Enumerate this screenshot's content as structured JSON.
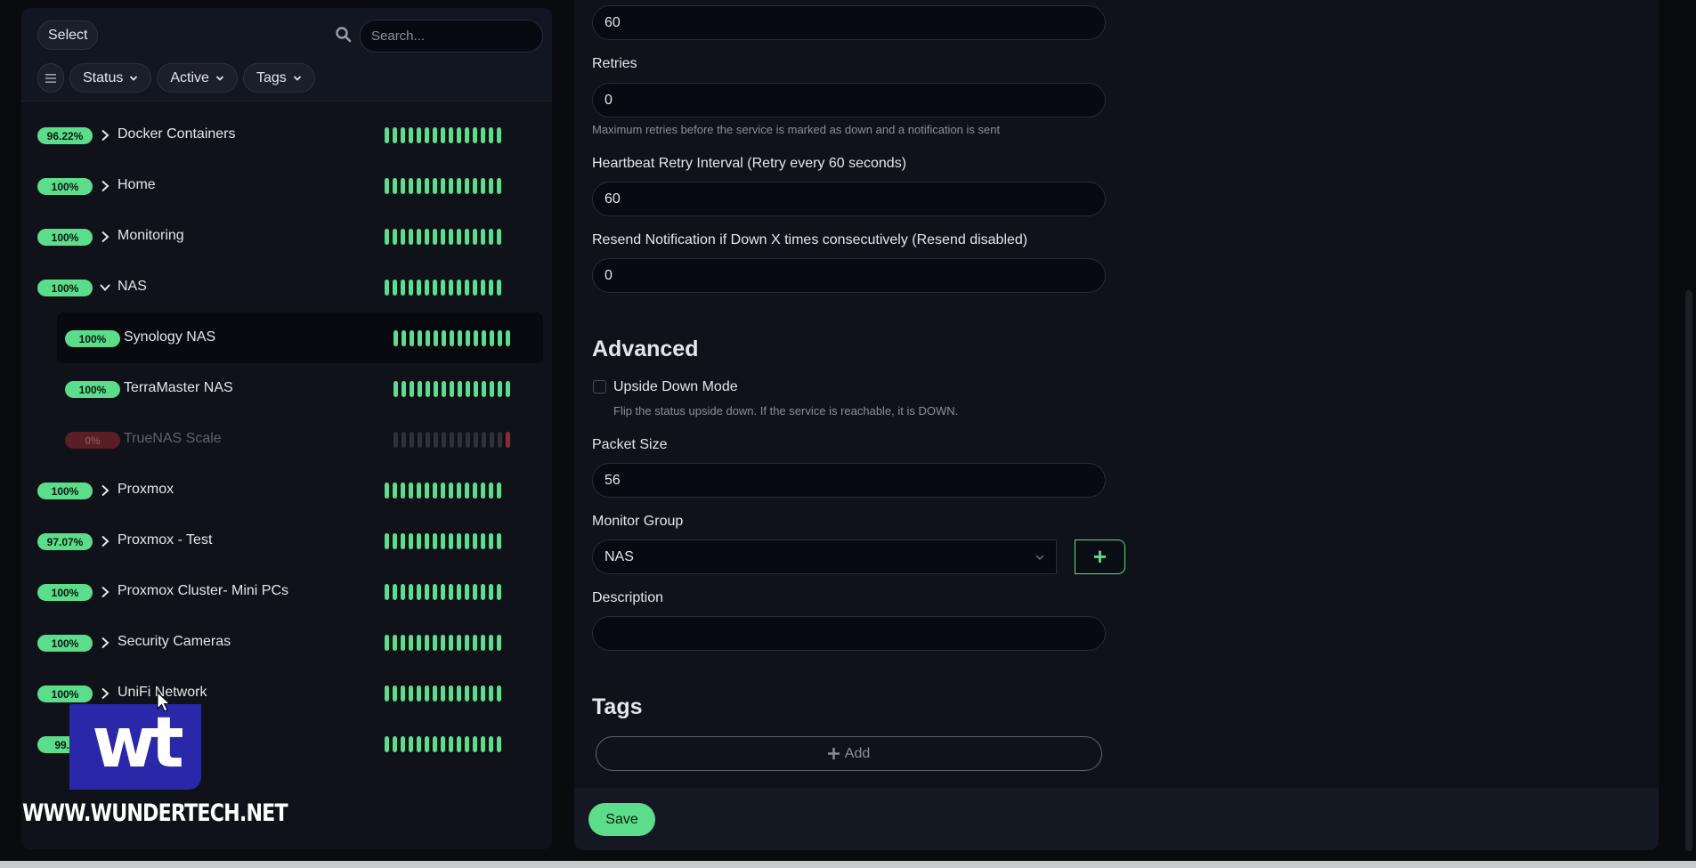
{
  "sidebar": {
    "select_label": "Select",
    "search_placeholder": "Search...",
    "filters": [
      {
        "label": "Status"
      },
      {
        "label": "Active"
      },
      {
        "label": "Tags"
      }
    ],
    "monitors": [
      {
        "uptime": "96.22%",
        "name": "Docker Containers",
        "expanded": false,
        "status": "up"
      },
      {
        "uptime": "100%",
        "name": "Home",
        "expanded": false,
        "status": "up"
      },
      {
        "uptime": "100%",
        "name": "Monitoring",
        "expanded": false,
        "status": "up"
      },
      {
        "uptime": "100%",
        "name": "NAS",
        "expanded": true,
        "status": "up"
      },
      {
        "uptime": "100%",
        "name": "Synology NAS",
        "child": true,
        "selected": true,
        "status": "up"
      },
      {
        "uptime": "100%",
        "name": "TerraMaster NAS",
        "child": true,
        "status": "up"
      },
      {
        "uptime": "0%",
        "name": "TrueNAS Scale",
        "child": true,
        "status": "down"
      },
      {
        "uptime": "100%",
        "name": "Proxmox",
        "expanded": false,
        "status": "up"
      },
      {
        "uptime": "97.07%",
        "name": "Proxmox - Test",
        "expanded": false,
        "status": "up"
      },
      {
        "uptime": "100%",
        "name": "Proxmox Cluster- Mini PCs",
        "expanded": false,
        "status": "up"
      },
      {
        "uptime": "100%",
        "name": "Security Cameras",
        "expanded": false,
        "status": "up"
      },
      {
        "uptime": "100%",
        "name": "UniFi Network",
        "expanded": false,
        "status": "up"
      },
      {
        "uptime": "99.8",
        "name": "",
        "expanded": false,
        "status": "up"
      }
    ]
  },
  "form": {
    "interval_value": "60",
    "retries_label": "Retries",
    "retries_value": "0",
    "retries_help": "Maximum retries before the service is marked as down and a notification is sent",
    "retry_interval_label": "Heartbeat Retry Interval (Retry every 60 seconds)",
    "retry_interval_value": "60",
    "resend_label": "Resend Notification if Down X times consecutively (Resend disabled)",
    "resend_value": "0",
    "advanced_title": "Advanced",
    "upside_down_label": "Upside Down Mode",
    "upside_down_help": "Flip the status upside down. If the service is reachable, it is DOWN.",
    "packet_size_label": "Packet Size",
    "packet_size_value": "56",
    "monitor_group_label": "Monitor Group",
    "monitor_group_value": "NAS",
    "add_group_symbol": "+",
    "description_label": "Description",
    "description_value": "",
    "tags_title": "Tags",
    "tags_add_label": "Add",
    "save_label": "Save"
  },
  "watermark": {
    "logo_text": "wt",
    "site_text": "WWW.WUNDERTECH.NET"
  },
  "colors": {
    "accent": "#5cdd8b",
    "down": "#5a1f24",
    "background": "#0f1219"
  }
}
